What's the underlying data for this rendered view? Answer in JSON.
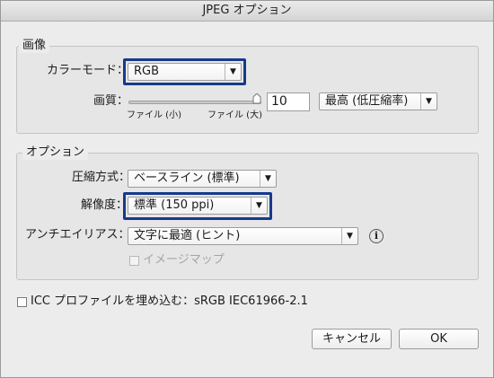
{
  "window": {
    "title": "JPEG オプション"
  },
  "image_group": {
    "title": "画像",
    "color_mode_label": "カラーモード：",
    "color_mode_value": "RGB",
    "quality_label": "画質：",
    "quality_value": "10",
    "quality_preset": "最高 (低圧縮率)",
    "slider_left_label": "ファイル (小)",
    "slider_right_label": "ファイル (大)"
  },
  "options_group": {
    "title": "オプション",
    "compression_label": "圧縮方式：",
    "compression_value": "ベースライン (標準)",
    "resolution_label": "解像度：",
    "resolution_value": "標準 (150 ppi)",
    "antialias_label": "アンチエイリアス：",
    "antialias_value": "文字に最適 (ヒント)",
    "imagemap_label": "イメージマップ"
  },
  "icc": {
    "label": "ICC プロファイルを埋め込む：sRGB IEC61966-2.1"
  },
  "buttons": {
    "cancel": "キャンセル",
    "ok": "OK"
  },
  "icons": {
    "dropdown": "triangle-down",
    "info": "info-circle"
  }
}
